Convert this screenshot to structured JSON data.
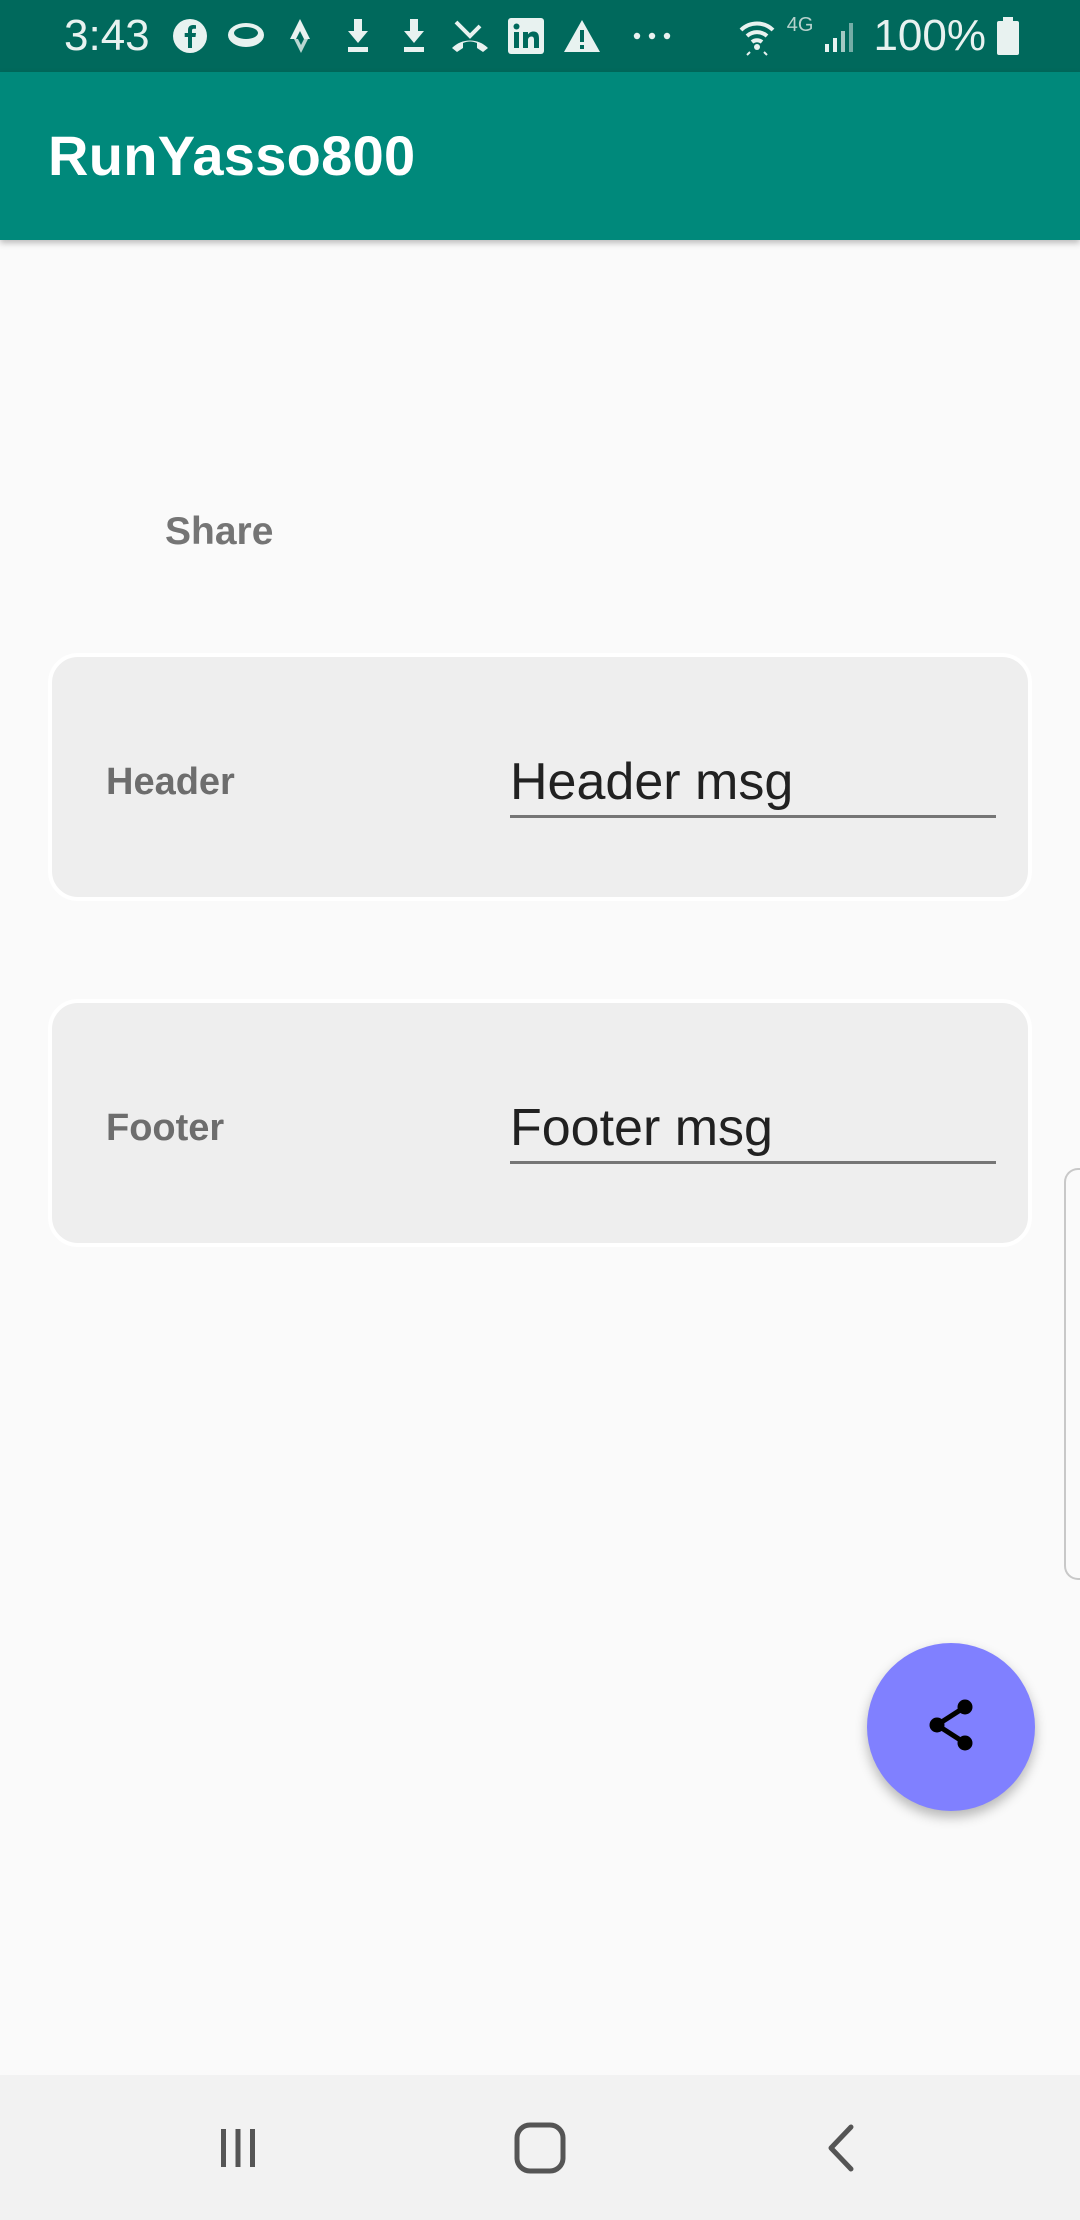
{
  "status_bar": {
    "time": "3:43",
    "battery_text": "100%",
    "network_label": "4G",
    "left_icons": [
      "facebook-icon",
      "chat-bubble-icon",
      "strava-icon",
      "download-icon",
      "download-icon",
      "missed-call-icon",
      "linkedin-icon",
      "warning-icon",
      "more-dots-icon"
    ],
    "right_icons": [
      "wifi-icon",
      "network-4g-icon",
      "signal-icon",
      "battery-icon"
    ]
  },
  "app_bar": {
    "title": "RunYasso800"
  },
  "main": {
    "share_label": "Share",
    "header_card": {
      "label": "Header",
      "input_value": "Header msg"
    },
    "footer_card": {
      "label": "Footer",
      "input_value": "Footer msg"
    }
  },
  "fab": {
    "icon": "share-icon"
  },
  "nav_bar": {
    "buttons": [
      "recents-icon",
      "home-icon",
      "back-icon"
    ]
  },
  "colors": {
    "status_bar": "#00695c",
    "app_bar": "#00897b",
    "fab": "#8080ff",
    "background": "#fafafa",
    "card": "#eeeeee"
  }
}
